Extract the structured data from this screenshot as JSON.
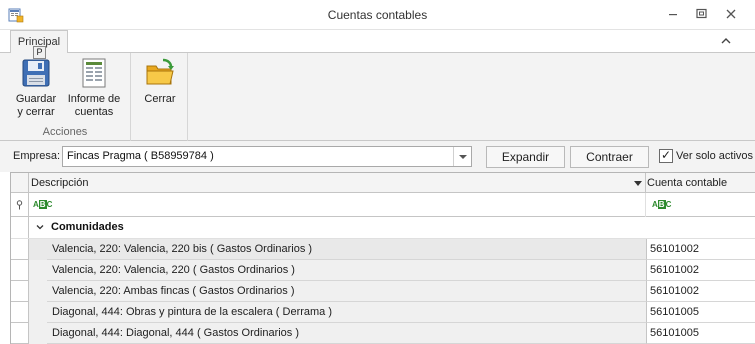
{
  "window": {
    "title": "Cuentas contables",
    "controls": [
      "minimize-icon",
      "restore-icon",
      "close-icon"
    ]
  },
  "ribbon": {
    "tab": "Principal",
    "keytip": "P",
    "groups": [
      {
        "label": "Acciones",
        "buttons": [
          {
            "line1": "Guardar",
            "line2": "y cerrar",
            "icon": "save-icon"
          },
          {
            "line1": "Informe de",
            "line2": "cuentas",
            "icon": "report-icon"
          }
        ]
      },
      {
        "label": "",
        "buttons": [
          {
            "line1": "Cerrar",
            "line2": "",
            "icon": "folder-close-icon"
          }
        ]
      }
    ]
  },
  "toolbar": {
    "empresa_label": "Empresa:",
    "empresa_value": "Fincas Pragma ( B58959784 )",
    "expandir_label": "Expandir",
    "contraer_label": "Contraer",
    "solo_activos_label": "Ver solo activos",
    "solo_activos_checked": true
  },
  "grid": {
    "columns": [
      "Descripción",
      "Cuenta contable"
    ],
    "filter_icon": "abc-filter-icon",
    "group": "Comunidades",
    "rows": [
      {
        "descripcion": "Valencia, 220: Valencia, 220 bis ( Gastos Ordinarios )",
        "cuenta": "56101002"
      },
      {
        "descripcion": "Valencia, 220: Valencia, 220 ( Gastos Ordinarios )",
        "cuenta": "56101002"
      },
      {
        "descripcion": "Valencia, 220: Ambas fincas ( Gastos Ordinarios )",
        "cuenta": "56101002"
      },
      {
        "descripcion": "Diagonal, 444: Obras y pintura de la escalera ( Derrama )",
        "cuenta": "56101005"
      },
      {
        "descripcion": "Diagonal, 444: Diagonal, 444 ( Gastos Ordinarios )",
        "cuenta": "56101005"
      }
    ]
  },
  "colors": {
    "ribbon_bg": "#f3f3f3",
    "row_bg": "#f0f0f0",
    "accent_green": "#2d8a2d"
  }
}
